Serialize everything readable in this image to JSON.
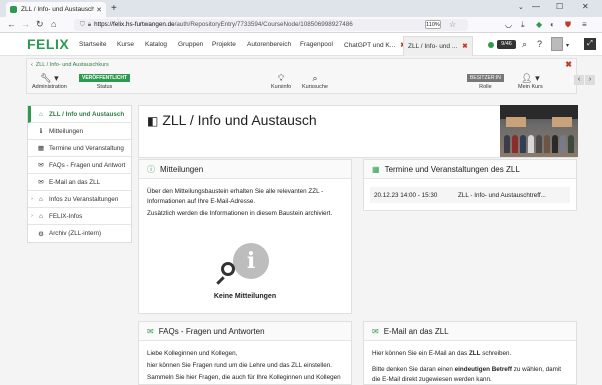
{
  "browser": {
    "tab_title": "ZLL / Info- und Austauschkurs",
    "new_tab": "+",
    "url_host": "https://felix.hs-furtwangen.de",
    "url_path": "/auth/RepositoryEntry/7733594/CourseNode/108506998927486",
    "zoom": "110%",
    "nav": {
      "back": "←",
      "forward": "→",
      "reload": "↻",
      "home": "⌂"
    },
    "window": {
      "minimize": "—",
      "maximize": "☐",
      "close": "✕"
    }
  },
  "site": {
    "logo": "FELIX",
    "nav": [
      "Startseite",
      "Kurse",
      "Katalog",
      "Gruppen",
      "Projekte",
      "Autorenbereich",
      "Fragenpool"
    ],
    "tabs": [
      {
        "label": "ChatGPT und K...",
        "close": "✖"
      },
      {
        "label": "ZLL / Info- und ...",
        "close": "✖"
      }
    ],
    "counter": "9/46"
  },
  "toolbar": {
    "breadcrumb": "ZLL / Info- und Austauschkurs",
    "admin": "Administration",
    "status_badge": "VERÖFFENTLICHT",
    "status": "Status",
    "kursinfo": "Kursinfo",
    "kurssuche": "Kurssuche",
    "role_badge": "BESITZER:IN",
    "role": "Rolle",
    "mein_kurs": "Mein Kurs",
    "prev": "‹",
    "next": "›",
    "close": "✖"
  },
  "menu": {
    "items": [
      {
        "label": "ZLL / Info und Austausch",
        "icon": "⌂",
        "caret": ""
      },
      {
        "label": "Mitteilungen",
        "icon": "ℹ",
        "caret": ""
      },
      {
        "label": "Termine und Veranstaltung",
        "icon": "▦",
        "caret": ""
      },
      {
        "label": "FAQs - Fragen und Antwort",
        "icon": "✉",
        "caret": ""
      },
      {
        "label": "E-Mail an das ZLL",
        "icon": "✉",
        "caret": ""
      },
      {
        "label": "Infos zu Veranstaltungen",
        "icon": "⌂",
        "caret": "›"
      },
      {
        "label": "FELIX-Infos",
        "icon": "⌂",
        "caret": "›"
      },
      {
        "label": "Archiv (ZLL-intern)",
        "icon": "⚙",
        "caret": ""
      }
    ]
  },
  "page": {
    "title": "ZLL / Info und Austausch"
  },
  "mitteilungen": {
    "title": "Mitteilungen",
    "p1": "Über den Mitteilungsbaustein erhalten Sie alle relevanten ZZL - Informationen auf Ihre E-Mail-Adresse.",
    "p2": "Zusätzlich werden die Informationen in diesem Baustein archiviert.",
    "empty": "Keine Mitteilungen"
  },
  "termine": {
    "title": "Termine und Veranstaltungen des ZLL",
    "rows": [
      {
        "date": "20.12.23 14:00 - 15:30",
        "name": "ZLL - Info- und Austauschtreff..."
      }
    ]
  },
  "faqs": {
    "title": "FAQs - Fragen und Antworten",
    "p1": "Liebe Kolleginnen und Kollegen,",
    "p2": "hier können Sie Fragen rund um die Lehre und das ZLL einstellen.",
    "p3": "Sammeln Sie hier Fragen, die auch für Ihre Kolleginnen und Kollegen"
  },
  "email": {
    "title": "E-Mail an das ZLL",
    "p1_pre": "Hier können Sie ein E-Mail an das ",
    "p1_bold": "ZLL",
    "p1_post": " schreiben.",
    "p2_pre": "Bitte denken Sie daran einen ",
    "p2_bold": "eindeutigen Betreff",
    "p2_post": " zu wählen, damit die E-Mail direkt zugewiesen werden kann."
  }
}
